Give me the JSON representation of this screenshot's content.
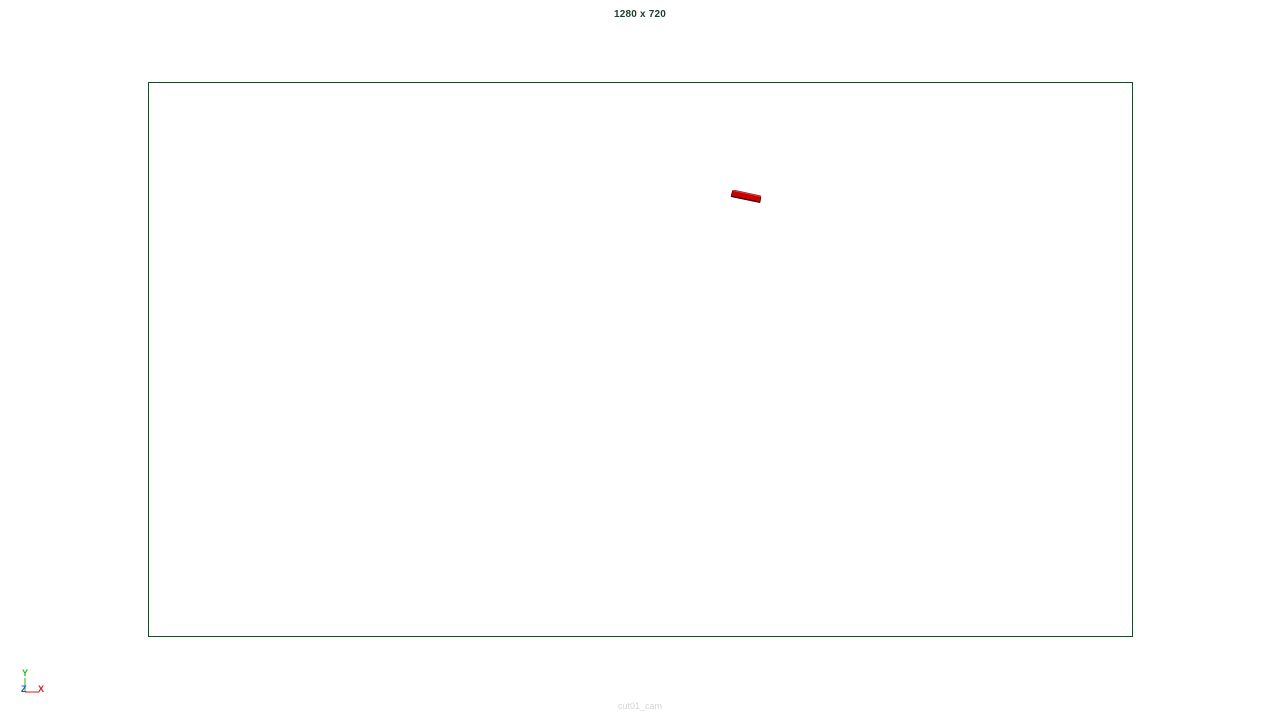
{
  "viewport": {
    "resolution_label": "1280 x 720",
    "camera_name": "cut01_cam"
  },
  "axis_gizmo": {
    "y_label": "Y",
    "z_label": "Z",
    "x_label": "X",
    "colors": {
      "y": "#22bb22",
      "z": "#1a4fd6",
      "x": "#e01919"
    }
  },
  "colors": {
    "gate_border": "#1e4a2a",
    "object_fill": "#cc0000",
    "object_edge": "#4a0000",
    "label_text": "#1f3d2c"
  }
}
